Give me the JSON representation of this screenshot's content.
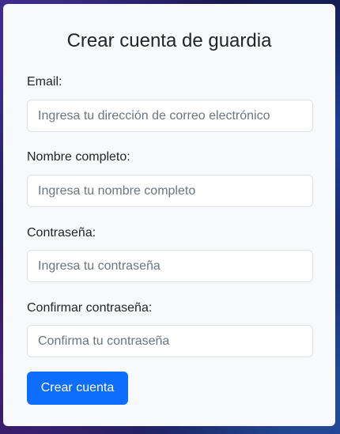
{
  "form": {
    "title": "Crear cuenta de guardia",
    "fields": [
      {
        "label": "Email:",
        "placeholder": "Ingresa tu dirección de correo electrónico",
        "value": ""
      },
      {
        "label": "Nombre completo:",
        "placeholder": "Ingresa tu nombre completo",
        "value": ""
      },
      {
        "label": "Contraseña:",
        "placeholder": "Ingresa tu contraseña",
        "value": ""
      },
      {
        "label": "Confirmar contraseña:",
        "placeholder": "Confirma tu contraseña",
        "value": ""
      }
    ],
    "submit_label": "Crear cuenta"
  },
  "colors": {
    "primary": "#0d6efd",
    "card_background": "#f8f9fa",
    "text": "#212529",
    "placeholder": "#6c757d"
  }
}
